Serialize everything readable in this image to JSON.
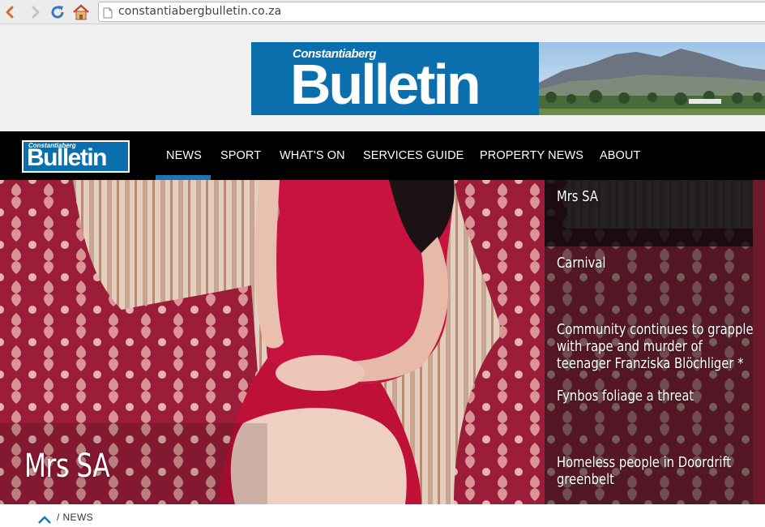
{
  "browser": {
    "url": "constantiabergbulletin.co.za"
  },
  "banner": {
    "small_title": "Constantiaberg",
    "big_title": "Bulletin"
  },
  "nav": {
    "logo_small": "Constantiaberg",
    "logo_big": "Bulletin",
    "items": [
      {
        "label": "NEWS",
        "active": true
      },
      {
        "label": "SPORT",
        "active": false
      },
      {
        "label": "WHAT'S ON",
        "active": false
      },
      {
        "label": "SERVICES GUIDE",
        "active": false
      },
      {
        "label": "PROPERTY NEWS",
        "active": false
      },
      {
        "label": "ABOUT",
        "active": false
      }
    ]
  },
  "hero": {
    "caption": "Mrs SA",
    "headlines": [
      "Mrs SA",
      "Carnival",
      "Community continues to grapple with rape and murder of teenager Franziska Blöchliger *",
      "Fynbos foliage a threat",
      "Homeless people in Doordrift greenbelt"
    ]
  },
  "breadcrumb": {
    "label": "/ NEWS"
  },
  "colors": {
    "brand_blue": "#0b6fae",
    "nav_active": "#1b76b8",
    "nav_bg": "#000000"
  }
}
